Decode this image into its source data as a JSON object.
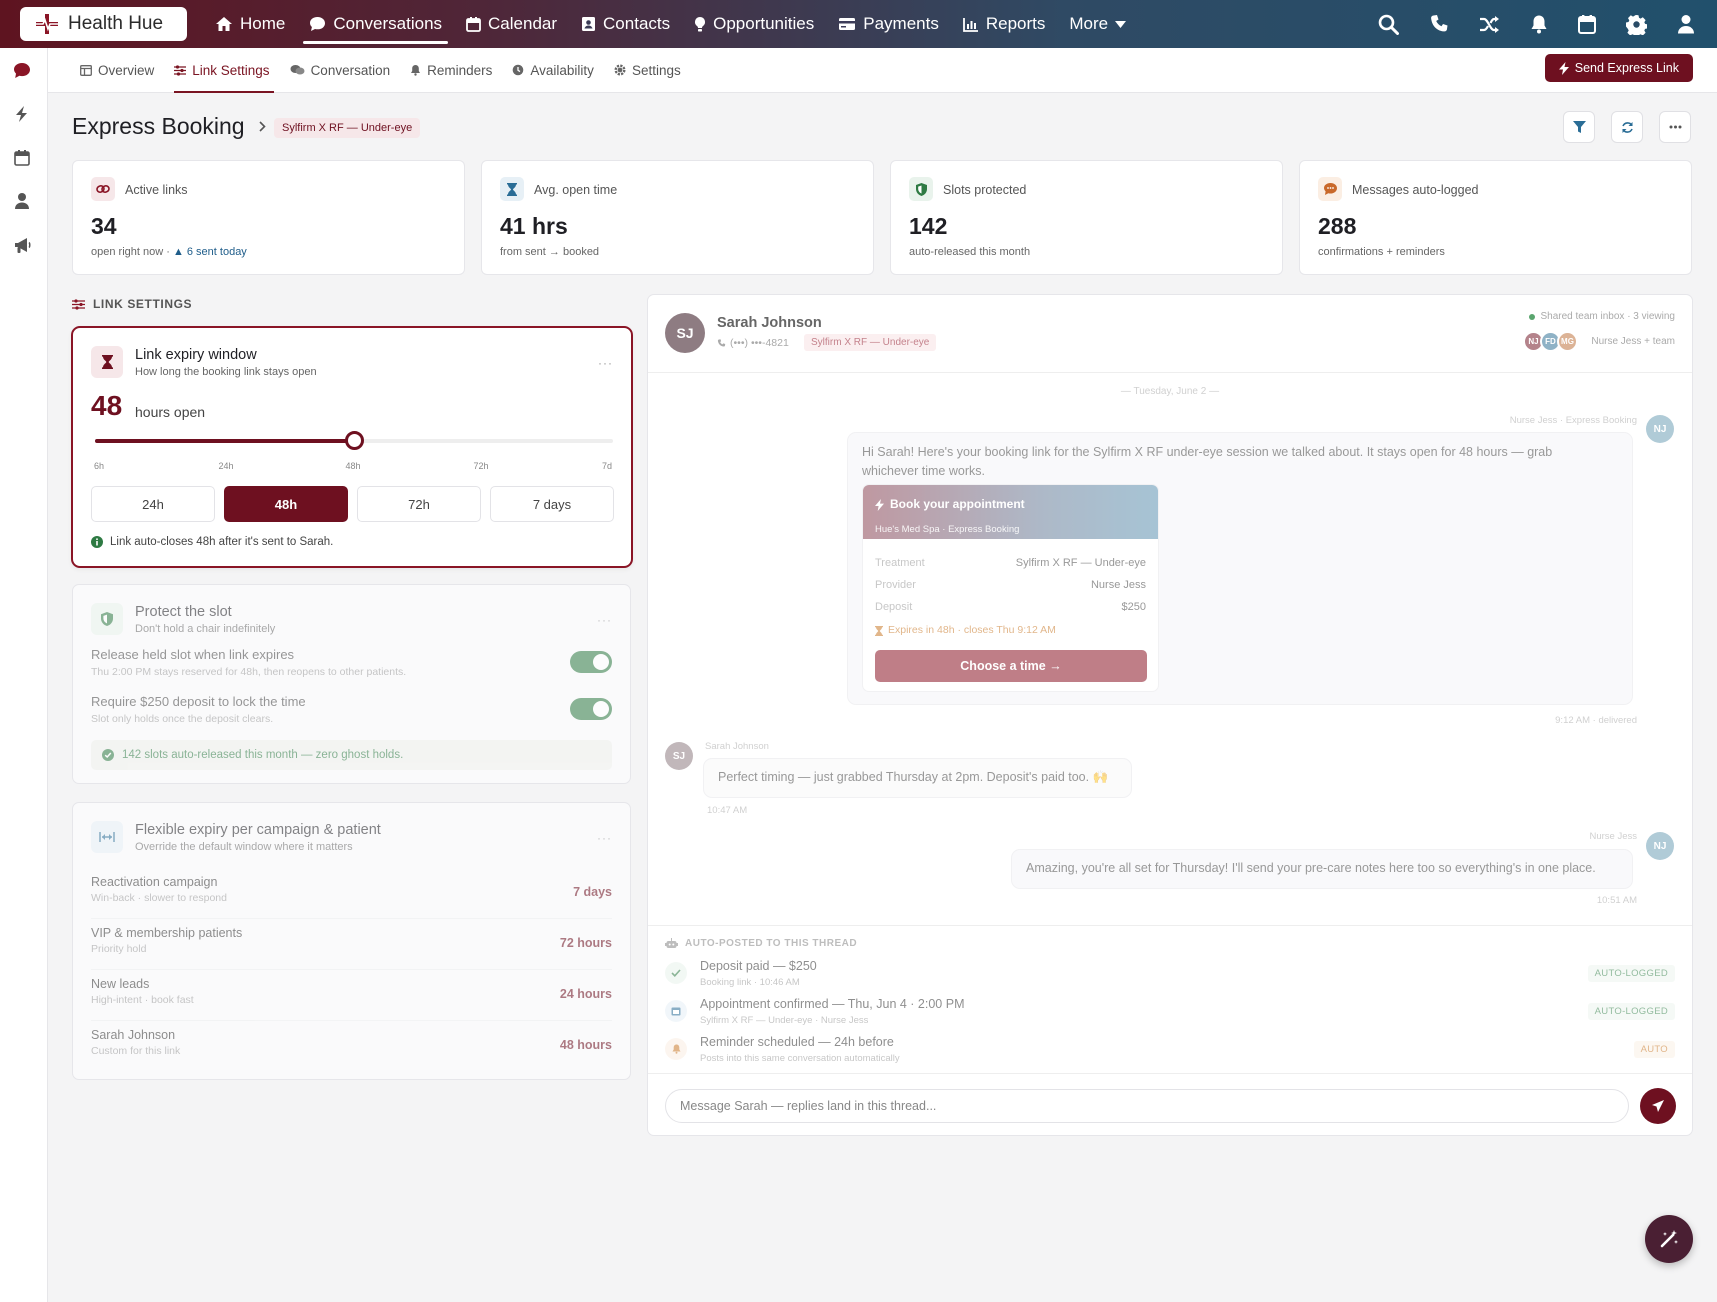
{
  "app": {
    "name": "Health Hue"
  },
  "nav": {
    "items": [
      {
        "label": "Home",
        "icon": "home-icon"
      },
      {
        "label": "Conversations",
        "icon": "chat-icon"
      },
      {
        "label": "Calendar",
        "icon": "calendar-icon"
      },
      {
        "label": "Contacts",
        "icon": "contacts-icon"
      },
      {
        "label": "Opportunities",
        "icon": "lightbulb-icon"
      },
      {
        "label": "Payments",
        "icon": "card-icon"
      },
      {
        "label": "Reports",
        "icon": "chart-icon"
      },
      {
        "label": "More",
        "icon": "chevron-down-icon"
      }
    ],
    "active": "Conversations"
  },
  "subnav": {
    "tabs": [
      {
        "label": "Overview"
      },
      {
        "label": "Link Settings"
      },
      {
        "label": "Conversation"
      },
      {
        "label": "Reminders"
      },
      {
        "label": "Availability"
      },
      {
        "label": "Settings"
      }
    ],
    "active": "Link Settings",
    "send_label": "Send Express Link"
  },
  "page": {
    "title": "Express Booking",
    "badge": "Sylfirm X RF — Under-eye"
  },
  "stats": [
    {
      "label": "Active links",
      "value": "34",
      "sub": "open right now · ",
      "sub_accent": "▲ 6 sent today"
    },
    {
      "label": "Avg. open time",
      "value": "41 hrs",
      "sub": "from sent → booked"
    },
    {
      "label": "Slots protected",
      "value": "142",
      "sub": "auto-released this month"
    },
    {
      "label": "Messages auto-logged",
      "value": "288",
      "sub": "confirmations + reminders"
    }
  ],
  "section_label": "LINK SETTINGS",
  "expiry": {
    "title": "Link expiry window",
    "subtitle": "How long the booking link stays open",
    "value": "48",
    "unit": "hours open",
    "slider_fraction": 0.5,
    "ticks": [
      "6h",
      "24h",
      "48h",
      "72h",
      "7d"
    ],
    "options": [
      "24h",
      "48h",
      "72h",
      "7 days"
    ],
    "selected": "48h",
    "hint": "Link auto-closes 48h after it's sent to Sarah."
  },
  "protect": {
    "title": "Protect the slot",
    "subtitle": "Don't hold a chair indefinitely",
    "rows": [
      {
        "label": "Release held slot when link expires",
        "desc": "Thu 2:00 PM stays reserved for 48h, then reopens to other patients.",
        "on": true
      },
      {
        "label": "Require $250 deposit to lock the time",
        "desc": "Slot only holds once the deposit clears.",
        "on": true
      }
    ],
    "note": "142 slots auto-released this month — zero ghost holds."
  },
  "flex": {
    "title": "Flexible expiry per campaign & patient",
    "subtitle": "Override the default window where it matters",
    "rows": [
      {
        "name": "Reactivation campaign",
        "desc": "Win-back · slower to respond",
        "value": "7 days"
      },
      {
        "name": "VIP & membership patients",
        "desc": "Priority hold",
        "value": "72 hours"
      },
      {
        "name": "New leads",
        "desc": "High-intent · book fast",
        "value": "24 hours"
      },
      {
        "name": "Sarah Johnson",
        "desc": "Custom for this link",
        "value": "48 hours"
      }
    ]
  },
  "conversation": {
    "contact": {
      "initials": "SJ",
      "name": "Sarah Johnson",
      "phone": "(•••) •••-4821",
      "tag": "Sylfirm X RF — Under-eye"
    },
    "inbox": {
      "status": "Shared team inbox · 3 viewing",
      "team": "Nurse Jess + team",
      "avatars": [
        "NJ",
        "FD",
        "MG"
      ]
    },
    "date_divider": "— Tuesday, June 2 —",
    "messages": [
      {
        "sender": "Nurse Jess · Express Booking",
        "initials": "NJ",
        "text": "Hi Sarah! Here's your booking link for the Sylfirm X RF under-eye session we talked about. It stays open for 48 hours — grab whichever time works.",
        "time": "9:12 AM · delivered"
      },
      {
        "sender": "Sarah Johnson",
        "initials": "SJ",
        "text": "Perfect timing — just grabbed Thursday at 2pm. Deposit's paid too. 🙌",
        "time": "10:47 AM"
      },
      {
        "sender": "Nurse Jess",
        "initials": "NJ",
        "text": "Amazing, you're all set for Thursday! I'll send your pre-care notes here too so everything's in one place.",
        "time": "10:51 AM"
      }
    ],
    "booking_card": {
      "title": "Book your appointment",
      "subtitle": "Hue's Med Spa · Express Booking",
      "rows": [
        {
          "k": "Treatment",
          "v": "Sylfirm X RF — Under-eye"
        },
        {
          "k": "Provider",
          "v": "Nurse Jess"
        },
        {
          "k": "Deposit",
          "v": "$250"
        }
      ],
      "expires": "Expires in 48h · closes Thu 9:12 AM",
      "cta": "Choose a time →"
    },
    "auto_header": "AUTO-POSTED TO THIS THREAD",
    "auto_items": [
      {
        "title": "Deposit paid — $250",
        "sub": "Booking link · 10:46 AM",
        "badge": "AUTO-LOGGED"
      },
      {
        "title": "Appointment confirmed — Thu, Jun 4 · 2:00 PM",
        "sub": "Sylfirm X RF — Under-eye · Nurse Jess",
        "badge": "AUTO-LOGGED"
      },
      {
        "title": "Reminder scheduled — 24h before",
        "sub": "Posts into this same conversation automatically",
        "badge": "AUTO"
      }
    ],
    "composer_placeholder": "Message Sarah — replies land in this thread..."
  },
  "colors": {
    "brand": "#6e1020",
    "success": "#2e7a43",
    "warning": "#c97a2a"
  }
}
